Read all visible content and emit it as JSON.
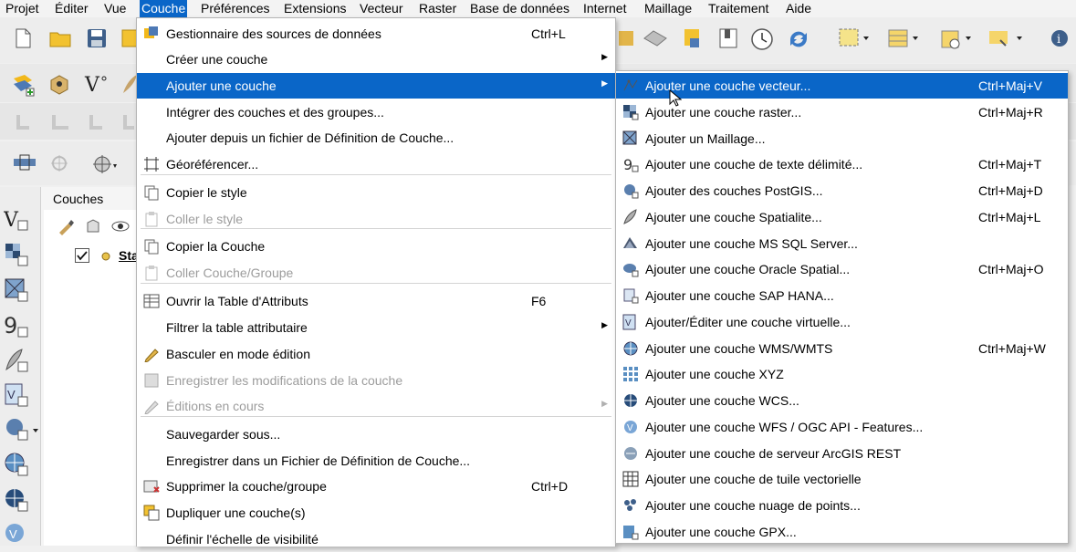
{
  "menubar": [
    "Projet",
    "Éditer",
    "Vue",
    "Couche",
    "Préférences",
    "Extensions",
    "Vecteur",
    "Raster",
    "Base de données",
    "Internet",
    "Maillage",
    "Traitement",
    "Aide"
  ],
  "active_menu": "Couche",
  "layers_panel": {
    "title": "Couches",
    "first_layer_label": "Sta"
  },
  "couche_menu": [
    {
      "label": "Gestionnaire des sources de données",
      "shortcut": "Ctrl+L",
      "icon": "data-source-manager-icon"
    },
    {
      "label": "Créer une couche",
      "submenu": true
    },
    {
      "label": "Ajouter une couche",
      "submenu": true,
      "highlighted": true
    },
    {
      "label": "Intégrer des couches et des groupes..."
    },
    {
      "label": "Ajouter depuis un fichier de Définition de Couche..."
    },
    {
      "label": "Géoréférencer...",
      "icon": "georeferencer-icon"
    },
    {
      "label": "Copier le style",
      "icon": "copy-style-icon"
    },
    {
      "label": "Coller le style",
      "disabled": true,
      "icon": "paste-style-icon"
    },
    {
      "label": "Copier la Couche",
      "icon": "copy-layer-icon"
    },
    {
      "label": "Coller Couche/Groupe",
      "disabled": true,
      "icon": "paste-layer-icon"
    },
    {
      "label": "Ouvrir la Table d'Attributs",
      "shortcut": "F6",
      "icon": "attribute-table-icon"
    },
    {
      "label": "Filtrer la table attributaire",
      "submenu": true
    },
    {
      "label": "Basculer en mode édition",
      "icon": "pencil-icon"
    },
    {
      "label": "Enregistrer les modifications de la couche",
      "disabled": true,
      "icon": "save-edits-icon"
    },
    {
      "label": "Éditions en cours",
      "disabled": true,
      "submenu": true,
      "icon": "current-edits-icon"
    },
    {
      "label": "Sauvegarder sous..."
    },
    {
      "label": "Enregistrer dans un Fichier de Définition de Couche..."
    },
    {
      "label": "Supprimer la couche/groupe",
      "shortcut": "Ctrl+D",
      "icon": "remove-layer-icon"
    },
    {
      "label": "Dupliquer une couche(s)",
      "icon": "duplicate-layer-icon"
    },
    {
      "label": "Définir l'échelle de visibilité"
    }
  ],
  "add_layer_submenu": [
    {
      "label": "Ajouter une couche vecteur...",
      "shortcut": "Ctrl+Maj+V",
      "highlighted": true,
      "icon": "vector-layer-icon"
    },
    {
      "label": "Ajouter une couche raster...",
      "shortcut": "Ctrl+Maj+R",
      "icon": "raster-layer-icon"
    },
    {
      "label": "Ajouter un Maillage...",
      "icon": "mesh-layer-icon"
    },
    {
      "label": "Ajouter une couche de texte délimité...",
      "shortcut": "Ctrl+Maj+T",
      "icon": "delimited-text-icon"
    },
    {
      "label": "Ajouter des couches PostGIS...",
      "shortcut": "Ctrl+Maj+D",
      "icon": "postgis-icon"
    },
    {
      "label": "Ajouter une couche Spatialite...",
      "shortcut": "Ctrl+Maj+L",
      "icon": "spatialite-icon"
    },
    {
      "label": "Ajouter une couche MS SQL Server...",
      "icon": "mssql-icon"
    },
    {
      "label": "Ajouter une couche Oracle Spatial...",
      "shortcut": "Ctrl+Maj+O",
      "icon": "oracle-icon"
    },
    {
      "label": "Ajouter une couche SAP HANA...",
      "icon": "sap-hana-icon"
    },
    {
      "label": "Ajouter/Éditer une couche virtuelle...",
      "icon": "virtual-layer-icon"
    },
    {
      "label": "Ajouter une couche WMS/WMTS",
      "shortcut": "Ctrl+Maj+W",
      "icon": "wms-icon"
    },
    {
      "label": "Ajouter une couche XYZ",
      "icon": "xyz-icon"
    },
    {
      "label": "Ajouter une couche WCS...",
      "icon": "wcs-icon"
    },
    {
      "label": "Ajouter une couche WFS / OGC API - Features...",
      "icon": "wfs-icon"
    },
    {
      "label": "Ajouter une couche de serveur ArcGIS REST",
      "icon": "arcgis-rest-icon"
    },
    {
      "label": "Ajouter une couche de tuile vectorielle",
      "icon": "vector-tile-icon"
    },
    {
      "label": "Ajouter une couche nuage de points...",
      "icon": "point-cloud-icon"
    },
    {
      "label": "Ajouter une couche GPX...",
      "icon": "gpx-icon"
    }
  ]
}
